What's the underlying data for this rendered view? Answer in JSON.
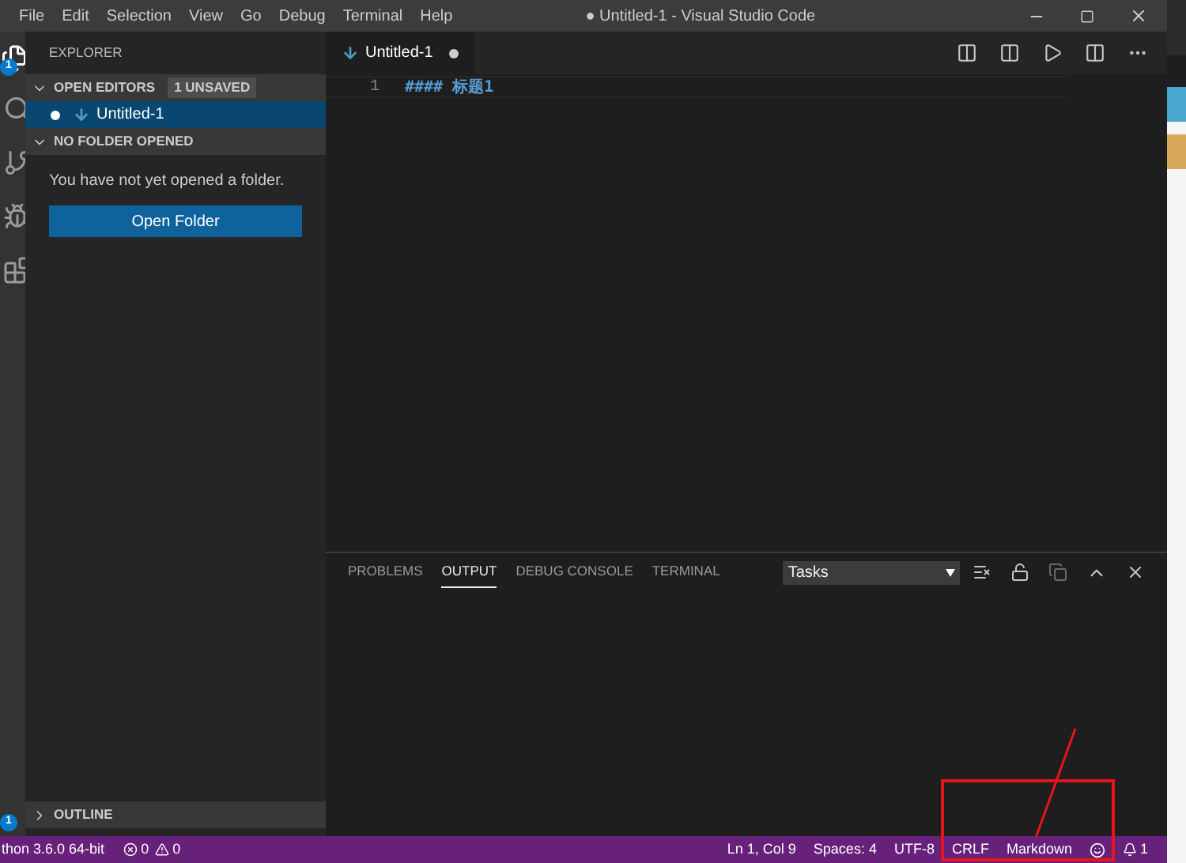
{
  "menu": [
    "File",
    "Edit",
    "Selection",
    "View",
    "Go",
    "Debug",
    "Terminal",
    "Help"
  ],
  "window": {
    "title": "● Untitled-1 - Visual Studio Code"
  },
  "activity_bar": {
    "top_badge": "1",
    "bottom_badge": "1"
  },
  "sidebar": {
    "title": "EXPLORER",
    "sections": [
      {
        "kind": "editors",
        "label": "OPEN EDITORS",
        "badge": "1 UNSAVED",
        "expanded": true,
        "items": [
          {
            "name": "Untitled-1",
            "dirty": true,
            "selected": true
          }
        ]
      },
      {
        "kind": "folder",
        "label": "NO FOLDER OPENED",
        "expanded": true,
        "message": "You have not yet opened a folder.",
        "button": "Open Folder"
      },
      {
        "kind": "outline",
        "label": "OUTLINE",
        "expanded": false
      }
    ]
  },
  "editor": {
    "tabs": [
      {
        "label": "Untitled-1",
        "dirty": true,
        "selected": true
      }
    ],
    "lines": [
      {
        "number": "1",
        "text": "#### 标题1"
      }
    ]
  },
  "panel": {
    "tabs": [
      {
        "label": "PROBLEMS",
        "selected": false
      },
      {
        "label": "OUTPUT",
        "selected": true
      },
      {
        "label": "DEBUG CONSOLE",
        "selected": false
      },
      {
        "label": "TERMINAL",
        "selected": false
      }
    ],
    "dropdown": "Tasks"
  },
  "status_bar": {
    "interpreter": "thon 3.6.0 64-bit",
    "errors": "0",
    "warnings": "0",
    "right": [
      "Ln 1, Col 9",
      "Spaces: 4",
      "UTF-8",
      "CRLF",
      "Markdown"
    ],
    "notifications": "1"
  }
}
